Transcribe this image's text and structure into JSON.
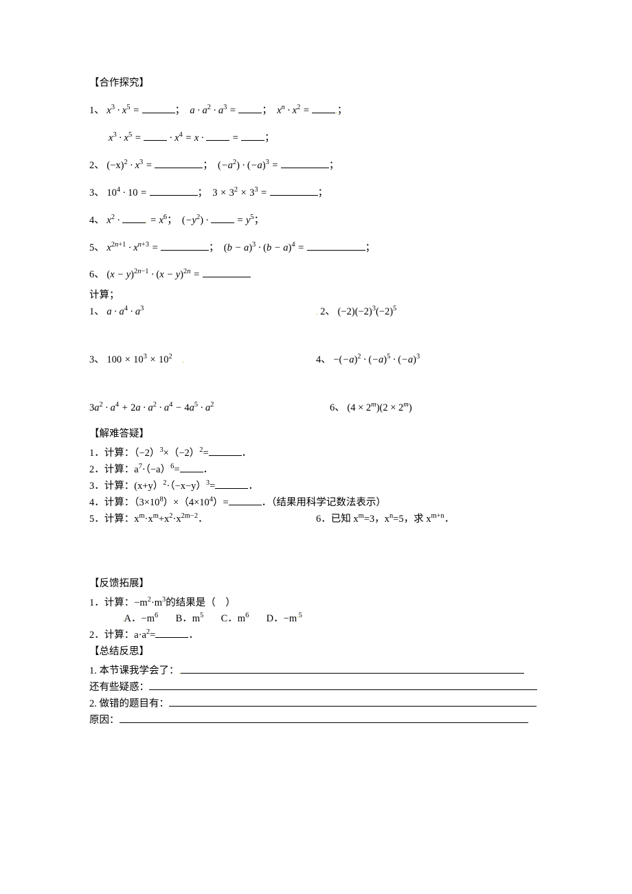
{
  "sec1_title": "【合作探究】",
  "p1_num": "1、",
  "p1_e1a": "x",
  "p1_e1ap": "3",
  "p1_e1b": "x",
  "p1_e1bp": "5",
  "p1_e2a": "a",
  "p1_e2b": "a",
  "p1_e2bp": "2",
  "p1_e2c": "a",
  "p1_e2cp": "3",
  "p1_e3a": "x",
  "p1_e3ap": "n",
  "p1_e3b": "x",
  "p1_e3bp": "2",
  "p1b_e1a": "x",
  "p1b_e1ap": "3",
  "p1b_e1b": "x",
  "p1b_e1bp": "5",
  "p1b_e2a": "x",
  "p1b_e2ap": "4",
  "p1b_e3a": "x",
  "p2_num": "2、",
  "p2_e1a": "(−x)",
  "p2_e1ap": "2",
  "p2_e1b": "x",
  "p2_e1bp": "3",
  "p2_e2a": "(−a",
  "p2_e2ap": "2",
  "p2_e2ac": ")",
  "p2_e2b": "(−a)",
  "p2_e2bp": "3",
  "p3_num": "3、",
  "p3_e1a": "10",
  "p3_e1ap": "4",
  "p3_e1b": "10",
  "p3_e2a": "3",
  "p3_e2b": "3",
  "p3_e2bp": "2",
  "p3_e2c": "3",
  "p3_e2cp": "3",
  "p4_num": "4、",
  "p4_e1a": "x",
  "p4_e1ap": "2",
  "p4_e1r": "x",
  "p4_e1rp": "6",
  "p4_e2a": "(−y",
  "p4_e2ap": "2",
  "p4_e2ac": ")",
  "p4_e2r": "y",
  "p4_e2rp": "5",
  "p5_num": "5、",
  "p5_e1a": "x",
  "p5_e1ap": "2n+1",
  "p5_e1b": "x",
  "p5_e1bp": "n+3",
  "p5_e2a": "(b − a)",
  "p5_e2ap": "3",
  "p5_e2b": "(b − a)",
  "p5_e2bp": "4",
  "p6_num": "6、",
  "p6_e1a": "(x − y)",
  "p6_e1ap": "2n−1",
  "p6_e1b": "(x − y)",
  "p6_e1bp": "2n",
  "calc_head": "计算；",
  "c1_num": "1、",
  "c1_a": "a",
  "c1_b": "a",
  "c1_bp": "4",
  "c1_c": "a",
  "c1_cp": "3",
  "c2_num": "2、",
  "c2_a": "(−2)",
  "c2_b": "(−2)",
  "c2_bp": "3",
  "c2_c": "(−2)",
  "c2_cp": "5",
  "c3_num": "3、",
  "c3_a": "100",
  "c3_b": "10",
  "c3_bp": "3",
  "c3_c": "10",
  "c3_cp": "2",
  "c4_num": "4、",
  "c4_pre": "−",
  "c4_a": "(−a)",
  "c4_ap": "2",
  "c4_b": "(−a)",
  "c4_bp": "5",
  "c4_c": "(−a)",
  "c4_cp": "3",
  "c5_a": "3a",
  "c5_ap": "2",
  "c5_b": "a",
  "c5_bp": "4",
  "c5_c": "2a",
  "c5_d": "a",
  "c5_dp": "2",
  "c5_e": "a",
  "c5_ep": "4",
  "c5_f": "4a",
  "c5_fp": "5",
  "c5_g": "a",
  "c5_gp": "2",
  "c6_num": "6、",
  "c6_a": "(4 × 2",
  "c6_ap": "m",
  "c6_ac": ")",
  "c6_b": "(2 × 2",
  "c6_bp": "m",
  "c6_bc": ")",
  "sec2_title": "【解难答疑】",
  "q1": "1．计算：（−2）",
  "q1_p1": "3",
  "q1_mid": "×（−2）",
  "q1_p2": "2",
  "q1_tail": "=",
  "q2": "2．计算：a",
  "q2_p1": "7",
  "q2_mid": "·（−a）",
  "q2_p2": "6",
  "q2_tail": "=",
  "q3": "3．计算：(x+y）",
  "q3_p1": "2",
  "q3_mid": "·（−x−y）",
  "q3_p2": "3",
  "q3_tail": "=",
  "q4a": "4．计算：（3×10",
  "q4a_p": "8",
  "q4b": "）×（4×10",
  "q4b_p": "4",
  "q4c": "）=",
  "q4_note": "．（结果用科学记数法表示）",
  "q5": "5．计算：x",
  "q5_p1": "m",
  "q5_mid1": "·x",
  "q5_p2": "m",
  "q5_mid2": "+x",
  "q5_p3": "2",
  "q5_mid3": "·x",
  "q5_p4": "2m−2",
  "q5_tail": "．",
  "q6": "6．已知 x",
  "q6_p1": "m",
  "q6_mid1": "=3，x",
  "q6_p2": "n",
  "q6_mid2": "=5，求 x",
  "q6_p3": "m+n",
  "q6_tail": "．",
  "sec3_title": "【反馈拓展】",
  "f1": "1．计算：−m",
  "f1_p1": "2",
  "f1_mid": "·m",
  "f1_p2": "3",
  "f1_tail": "的结果是（　）",
  "f1_A_l": "A．",
  "f1_A": "−m",
  "f1_A_p": "6",
  "f1_B_l": "B．",
  "f1_B": "m",
  "f1_B_p": "5",
  "f1_C_l": "C．",
  "f1_C": "m",
  "f1_C_p": "6",
  "f1_D_l": "D．",
  "f1_D": "−m",
  "f1_D_p": "5",
  "f2": "2．计算：a·a",
  "f2_p": "2",
  "f2_tail": "=",
  "sec4_title": "【总结反思】",
  "s1": "1. 本节课我学会了：",
  "s2": "还有些疑惑：",
  "s3": "2. 做错的题目有：",
  "s4": "原因："
}
